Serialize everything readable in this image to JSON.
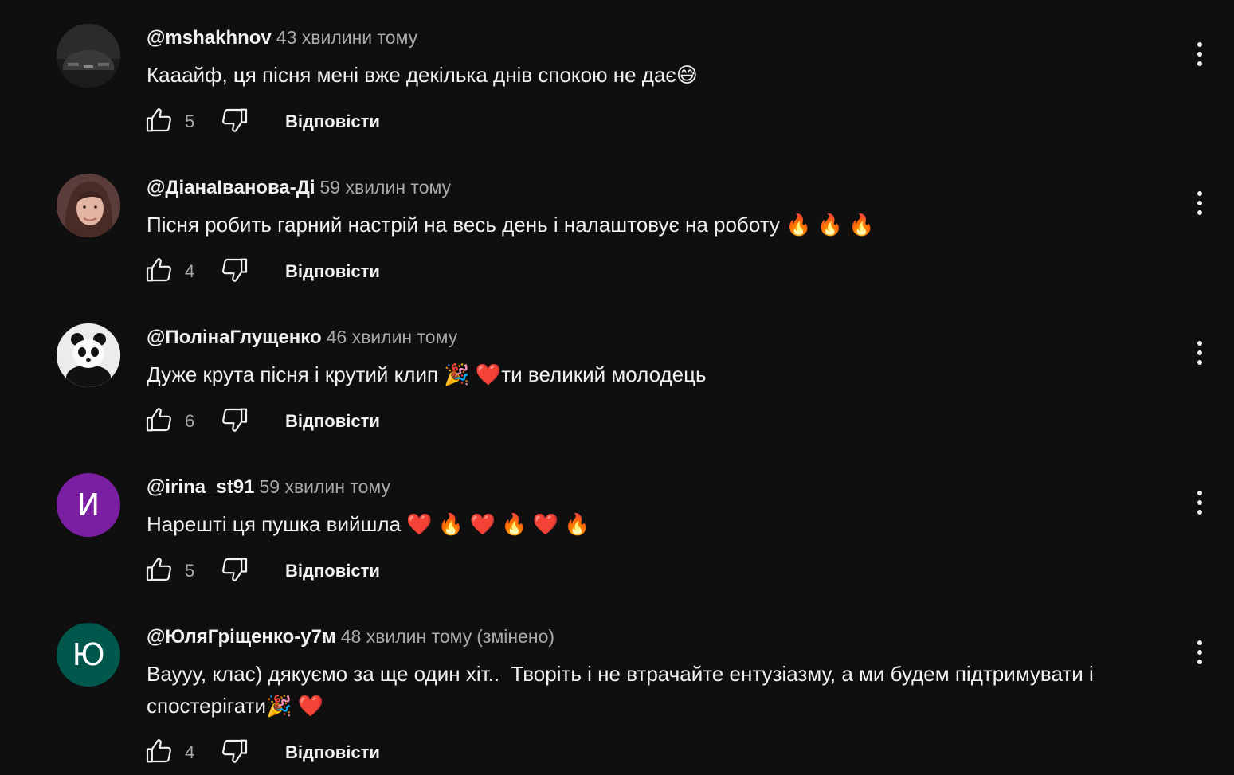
{
  "comments": [
    {
      "author": "@mshakhnov",
      "time": "43 хвилини тому",
      "edited": "",
      "text": "Кааайф, ця пісня мені вже декілька днів спокою не дає😅",
      "likes": "5",
      "reply_label": "Відповісти",
      "avatar": {
        "type": "image",
        "depicts": "car-photo",
        "letter": "",
        "color": "#2b2b2b"
      }
    },
    {
      "author": "@ДіанаІванова-Ді",
      "time": "59 хвилин тому",
      "edited": "",
      "text": "Пісня робить гарний настрій на весь день і налаштовує на роботу 🔥 🔥 🔥",
      "likes": "4",
      "reply_label": "Відповісти",
      "avatar": {
        "type": "image",
        "depicts": "woman-portrait",
        "letter": "",
        "color": "#7a5a58"
      }
    },
    {
      "author": "@ПолінаГлущенко",
      "time": "46 хвилин тому",
      "edited": "",
      "text": "Дуже крута пісня і крутий клип 🎉 ❤️ти великий молодець",
      "likes": "6",
      "reply_label": "Відповісти",
      "avatar": {
        "type": "image",
        "depicts": "panda-image",
        "letter": "",
        "color": "#e8e8e8"
      }
    },
    {
      "author": "@irina_st91",
      "time": "59 хвилин тому",
      "edited": "",
      "text": "Нарешті ця пушка вийшла ❤️ 🔥 ❤️ 🔥 ❤️ 🔥",
      "likes": "5",
      "reply_label": "Відповісти",
      "avatar": {
        "type": "letter",
        "depicts": "",
        "letter": "И",
        "color": "#7b1fa2"
      }
    },
    {
      "author": "@ЮляГріщенко-у7м",
      "time": "48 хвилин тому",
      "edited": "(змінено)",
      "text": "Ваууу, клас) дякуємо за ще один хіт..  Творіть і не втрачайте ентузіазму, а ми будем підтримувати і спостерігати🎉 ❤️",
      "likes": "4",
      "reply_label": "Відповісти",
      "avatar": {
        "type": "letter",
        "depicts": "",
        "letter": "Ю",
        "color": "#00574b"
      }
    }
  ],
  "icons": {
    "like": "thumb-up-icon",
    "dislike": "thumb-down-icon",
    "menu": "more-vert-icon"
  }
}
